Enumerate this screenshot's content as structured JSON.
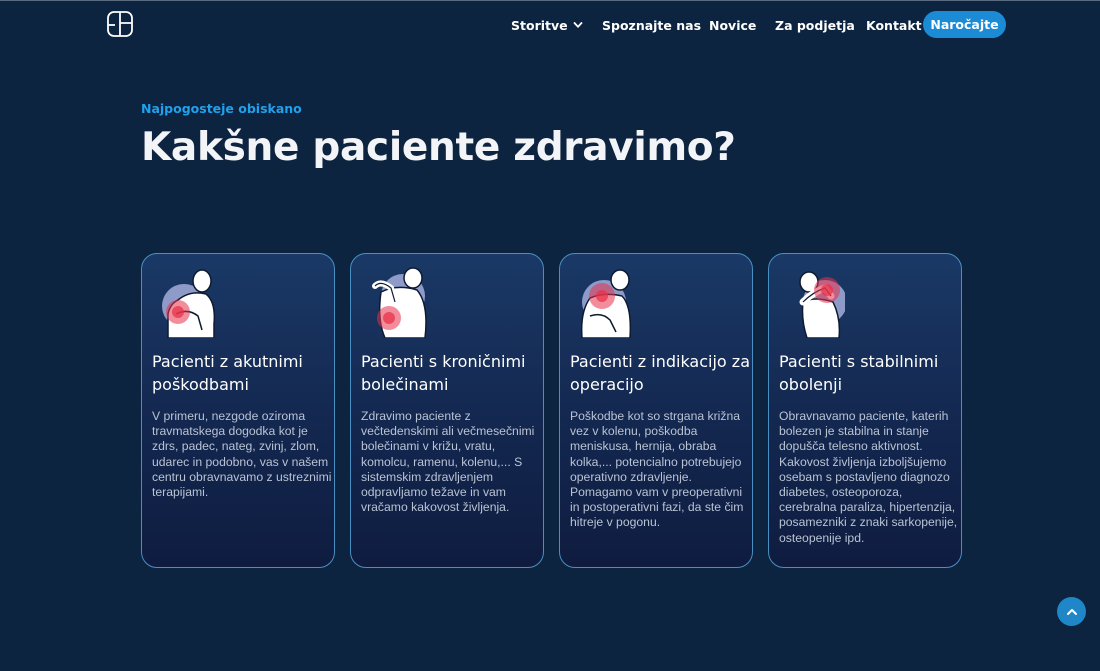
{
  "nav": {
    "items": [
      {
        "label": "Storitve",
        "has_dropdown": true
      },
      {
        "label": "Spoznajte nas"
      },
      {
        "label": "Novice"
      },
      {
        "label": "Za podjetja"
      },
      {
        "label": "Kontakt"
      }
    ],
    "cta_label": "Naročajte"
  },
  "hero": {
    "eyebrow": "Najpogosteje obiskano",
    "title": "Kakšne paciente zdravimo?"
  },
  "cards": [
    {
      "title": "Pacienti z akutnimi poškodbami",
      "text": "V primeru, nezgode oziroma travmatskega dogodka kot je zdrs, padec, nateg, zvinj, zlom, udarec in podobno, vas v našem centru obravnavamo z ustreznimi terapijami.",
      "icon": "shoulder-injury-icon"
    },
    {
      "title": "Pacienti s kroničnimi bolečinami",
      "text": "Zdravimo paciente z večtedenskimi ali večmesečnimi bolečinami v križu, vratu, komolcu, ramenu, kolenu,...  S sistemskim zdravljenjem odpravljamo težave in vam vračamo kakovost življenja.",
      "icon": "back-pain-icon"
    },
    {
      "title": "Pacienti z indikacijo za operacijo",
      "text": "Poškodbe kot so strgana križna vez v kolenu, poškodba meniskusa, hernija, obraba kolka,... potencialno potrebujejo operativno zdravljenje. Pomagamo vam v preoperativni in postoperativni fazi, da ste čim hitreje v pogonu.",
      "icon": "shoulder-surgery-icon"
    },
    {
      "title": "Pacienti s stabilnimi obolenji",
      "text": "Obravnavamo paciente, katerih bolezen je stabilna in stanje dopušča telesno aktivnost. Kakovost življenja izboljšujemo osebam s postavljeno diagnozo diabetes, osteoporoza, cerebralna paraliza, hipertenzija, posamezniki z znaki sarkopenije, osteopenije ipd.",
      "icon": "neck-pain-icon"
    }
  ],
  "colors": {
    "background": "#0d2440",
    "accent": "#1c8bd6",
    "eyebrow": "#21a0ec",
    "pain_highlight": "#e8324a"
  }
}
